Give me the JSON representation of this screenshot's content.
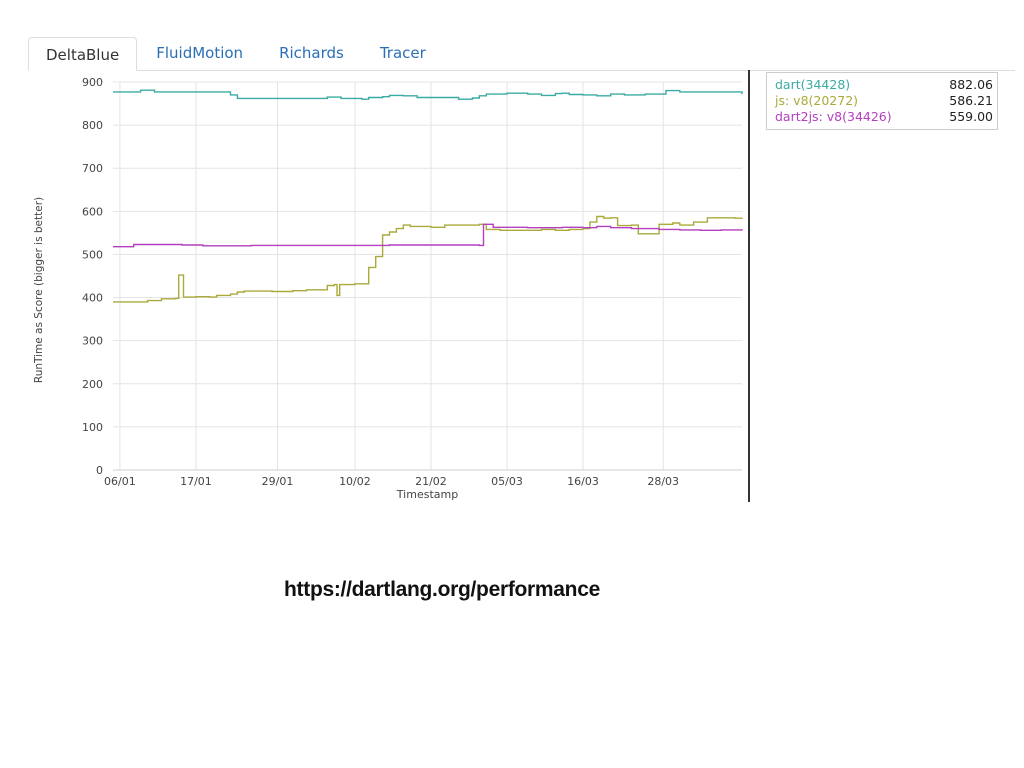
{
  "tabs": [
    {
      "label": "DeltaBlue",
      "active": true
    },
    {
      "label": "FluidMotion",
      "active": false
    },
    {
      "label": "Richards",
      "active": false
    },
    {
      "label": "Tracer",
      "active": false
    }
  ],
  "legend": [
    {
      "label": "dart(34428)",
      "value": "882.06",
      "color": "#3aaba4"
    },
    {
      "label": "js: v8(20272)",
      "value": "586.21",
      "color": "#aaaa3a"
    },
    {
      "label": "dart2js: v8(34426)",
      "value": "559.00",
      "color": "#b43fbf"
    }
  ],
  "footer": {
    "url": "https://dartlang.org/performance"
  },
  "chart_data": {
    "type": "line",
    "ylabel": "RunTime as Score (bigger is better)",
    "xlabel": "Timestamp",
    "ylim": [
      0,
      900
    ],
    "yticks": [
      0,
      100,
      200,
      300,
      400,
      500,
      600,
      700,
      800,
      900
    ],
    "xtick_labels": [
      "06/01",
      "17/01",
      "29/01",
      "10/02",
      "21/02",
      "05/03",
      "16/03",
      "28/03"
    ],
    "grid": true,
    "series": [
      {
        "name": "dart(34428)",
        "color": "#3aaba4",
        "points": [
          [
            0,
            877
          ],
          [
            3,
            877
          ],
          [
            4,
            881
          ],
          [
            6,
            877
          ],
          [
            16,
            877
          ],
          [
            17,
            870
          ],
          [
            18,
            862
          ],
          [
            30,
            862
          ],
          [
            31,
            865
          ],
          [
            33,
            862
          ],
          [
            36,
            860
          ],
          [
            37,
            864
          ],
          [
            39,
            866
          ],
          [
            40,
            869
          ],
          [
            42,
            868
          ],
          [
            44,
            864
          ],
          [
            50,
            860
          ],
          [
            52,
            863
          ],
          [
            53,
            868
          ],
          [
            54,
            872
          ],
          [
            57,
            874
          ],
          [
            60,
            872
          ],
          [
            62,
            869
          ],
          [
            64,
            873
          ],
          [
            65,
            874
          ],
          [
            66,
            871
          ],
          [
            68,
            870
          ],
          [
            70,
            868
          ],
          [
            72,
            872
          ],
          [
            74,
            870
          ],
          [
            77,
            872
          ],
          [
            80,
            880
          ],
          [
            82,
            877
          ],
          [
            90,
            877
          ],
          [
            91,
            872
          ]
        ]
      },
      {
        "name": "js: v8(20272)",
        "color": "#aaaa3a",
        "points": [
          [
            0,
            390
          ],
          [
            4,
            390
          ],
          [
            5,
            393
          ],
          [
            7,
            397
          ],
          [
            9,
            398
          ],
          [
            9.5,
            452
          ],
          [
            10,
            452
          ],
          [
            10.2,
            401
          ],
          [
            12,
            402
          ],
          [
            14,
            401
          ],
          [
            15,
            405
          ],
          [
            17,
            408
          ],
          [
            18,
            413
          ],
          [
            19,
            415
          ],
          [
            23,
            414
          ],
          [
            26,
            416
          ],
          [
            28,
            418
          ],
          [
            30,
            418
          ],
          [
            31,
            428
          ],
          [
            32,
            430
          ],
          [
            32.4,
            405
          ],
          [
            32.8,
            430
          ],
          [
            35,
            432
          ],
          [
            36,
            432
          ],
          [
            37,
            470
          ],
          [
            38,
            495
          ],
          [
            39,
            545
          ],
          [
            40,
            552
          ],
          [
            41,
            560
          ],
          [
            42,
            568
          ],
          [
            43,
            565
          ],
          [
            46,
            563
          ],
          [
            48,
            568
          ],
          [
            52,
            568
          ],
          [
            53,
            570
          ],
          [
            54,
            558
          ],
          [
            56,
            556
          ],
          [
            60,
            556
          ],
          [
            62,
            558
          ],
          [
            64,
            556
          ],
          [
            66,
            558
          ],
          [
            68,
            560
          ],
          [
            69,
            575
          ],
          [
            70,
            588
          ],
          [
            71,
            584
          ],
          [
            72,
            585
          ],
          [
            73,
            567
          ],
          [
            75,
            568
          ],
          [
            76,
            548
          ],
          [
            78,
            548
          ],
          [
            79,
            570
          ],
          [
            81,
            573
          ],
          [
            82,
            568
          ],
          [
            84,
            575
          ],
          [
            86,
            585
          ],
          [
            90,
            584
          ],
          [
            91,
            585
          ]
        ]
      },
      {
        "name": "dart2js: v8(34426)",
        "color": "#b43fbf",
        "points": [
          [
            0,
            518
          ],
          [
            2,
            518
          ],
          [
            3,
            523
          ],
          [
            10,
            522
          ],
          [
            13,
            520
          ],
          [
            20,
            521
          ],
          [
            30,
            521
          ],
          [
            40,
            522
          ],
          [
            50,
            522
          ],
          [
            53,
            521
          ],
          [
            53.6,
            570
          ],
          [
            55,
            563
          ],
          [
            60,
            562
          ],
          [
            65,
            563
          ],
          [
            68,
            562
          ],
          [
            70,
            565
          ],
          [
            72,
            562
          ],
          [
            75,
            560
          ],
          [
            79,
            558
          ],
          [
            82,
            557
          ],
          [
            85,
            556
          ],
          [
            88,
            557
          ],
          [
            91,
            555
          ]
        ]
      }
    ]
  }
}
